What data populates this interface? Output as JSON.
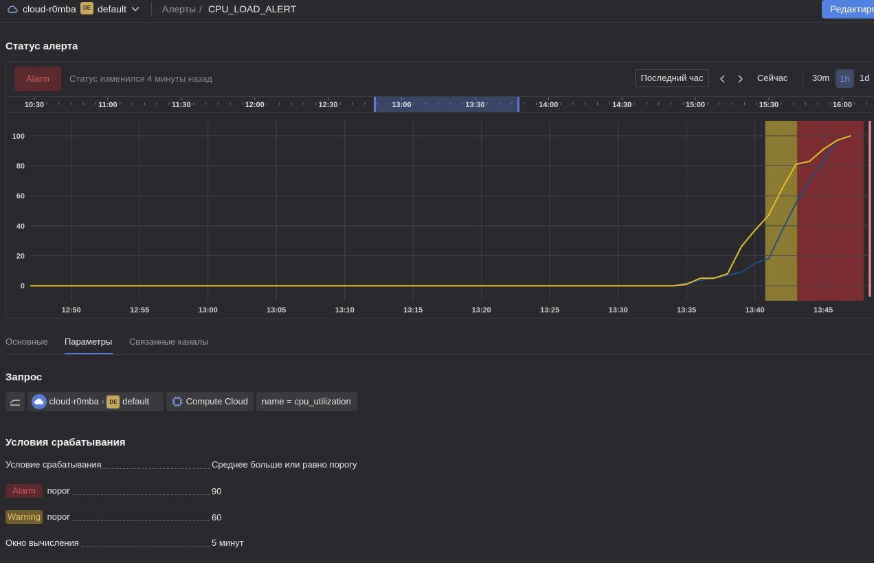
{
  "header": {
    "cloud_name": "cloud-r0mba",
    "folder_badge": "DE",
    "folder_name": "default",
    "breadcrumb_parent": "Алерты",
    "breadcrumb_sep": "/",
    "breadcrumb_current": "CPU_LOAD_ALERT",
    "edit_button": "Редактиро"
  },
  "status_section": {
    "title": "Статус алерта",
    "status_badge": "Alarm",
    "status_text": "Статус изменился 4 минуты назад",
    "range_button": "Последний час",
    "now_button": "Сейчас",
    "time_options": [
      "30m",
      "1h",
      "1d"
    ],
    "selected_time_option": "1h"
  },
  "timeline": {
    "ticks": [
      "10:30",
      "11:00",
      "11:30",
      "12:00",
      "12:30",
      "13:00",
      "13:30",
      "14:00",
      "14:30",
      "15:00",
      "15:30",
      "16:00"
    ]
  },
  "chart_data": {
    "type": "line",
    "title": "",
    "xlabel": "",
    "ylabel": "",
    "x_ticks": [
      "12:50",
      "12:55",
      "13:00",
      "13:05",
      "13:10",
      "13:15",
      "13:20",
      "13:25",
      "13:30",
      "13:35",
      "13:40",
      "13:45"
    ],
    "y_ticks": [
      0,
      20,
      40,
      60,
      80,
      100
    ],
    "ylim": [
      -10,
      110
    ],
    "xlim_minutes": [
      47,
      107
    ],
    "grid": true,
    "series": [
      {
        "color": "#e6c02a",
        "x": [
          47,
          94,
          95,
          96,
          97,
          98,
          99,
          100,
          101,
          102,
          103,
          104,
          105,
          106,
          107
        ],
        "y": [
          0,
          0,
          1,
          5,
          5,
          8,
          26,
          37,
          47,
          65,
          81,
          83,
          91,
          97,
          100
        ]
      },
      {
        "color": "#1f4e7a",
        "x": [
          94,
          98,
          99,
          100,
          101,
          102,
          103,
          104,
          105,
          106,
          107
        ],
        "y": [
          0,
          7,
          9,
          15,
          18,
          37,
          55,
          70,
          83,
          97,
          100
        ]
      }
    ],
    "bands": [
      {
        "from": 100.75,
        "to": 103.1,
        "color": "#8a7a32"
      },
      {
        "from": 103.1,
        "to": 107.95,
        "color": "#7a2c30"
      }
    ],
    "marker": {
      "x": 108.4,
      "color": "#f09090"
    }
  },
  "tabs": [
    "Основные",
    "Параметры",
    "Связанные каналы"
  ],
  "active_tab": "Параметры",
  "query": {
    "title": "Запрос",
    "cloud": "cloud-r0mba",
    "folder_badge": "DE",
    "folder": "default",
    "service": "Compute Cloud",
    "filter": "name = cpu_utilization"
  },
  "conditions": {
    "title": "Условия срабатывания",
    "condition_label": "Условие срабатывания",
    "condition_value": "Среднее больше или равно порогу",
    "alarm_badge": "Alarm",
    "alarm_label": "порог",
    "alarm_value": "90",
    "warning_badge": "Warning",
    "warning_label": "порог",
    "warning_value": "60",
    "window_label": "Окно вычисления",
    "window_value": "5 минут"
  }
}
